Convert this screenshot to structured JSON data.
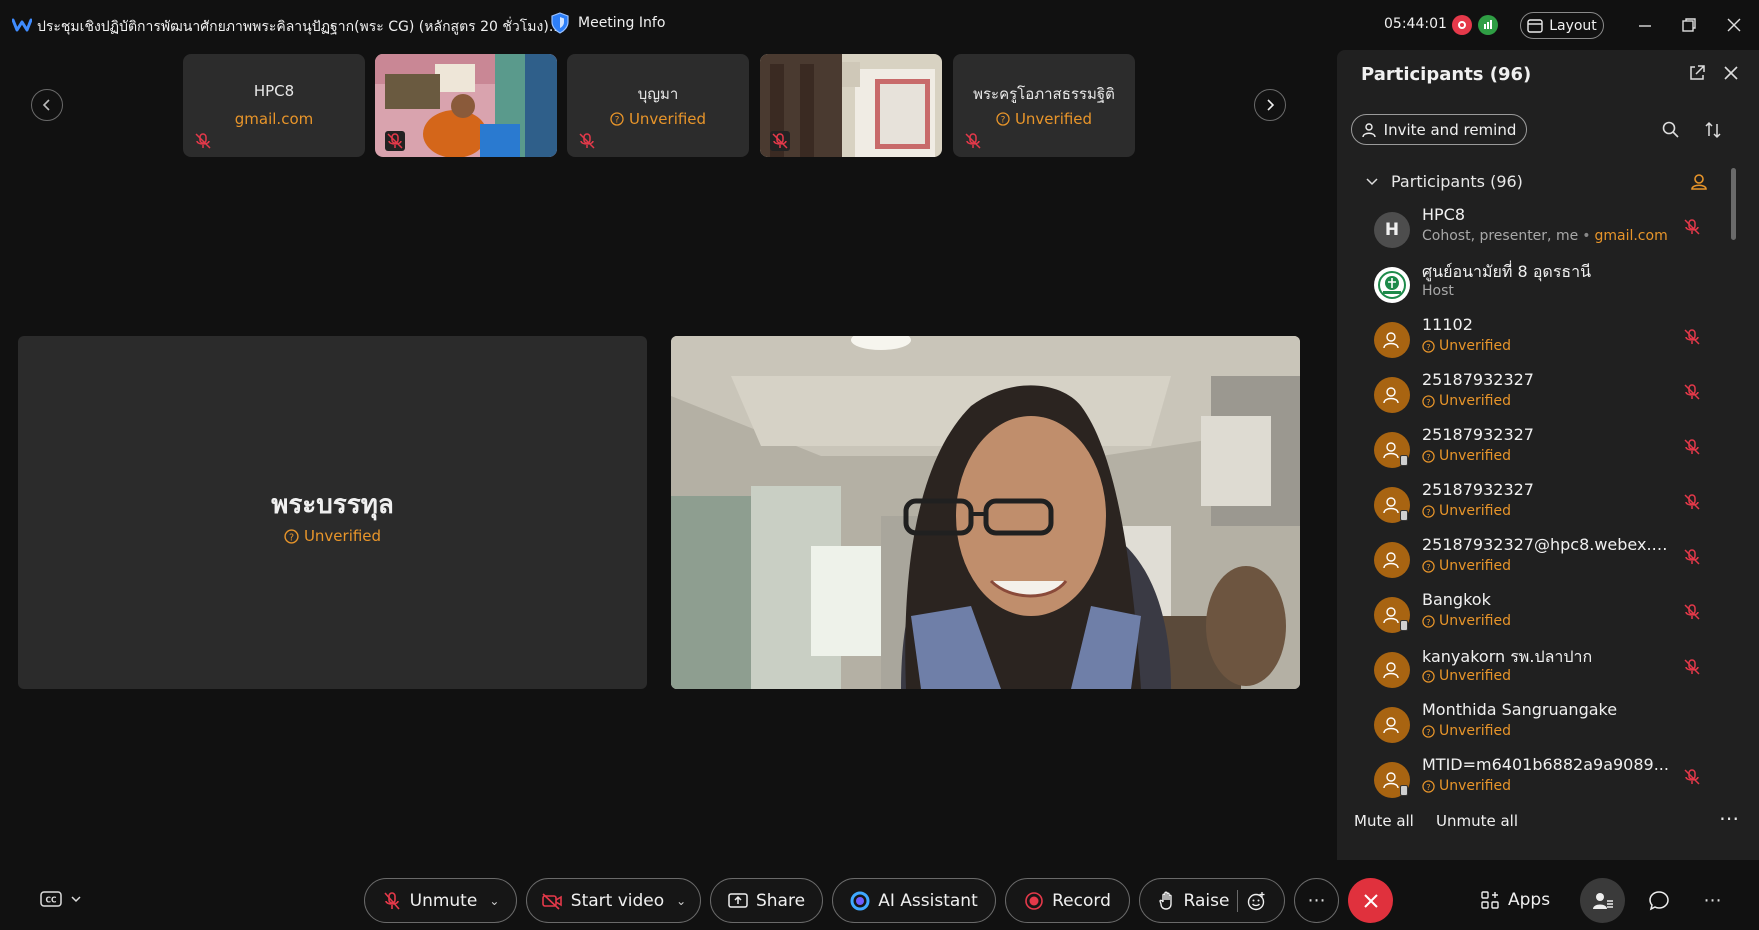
{
  "titlebar": {
    "meeting_title": "ประชุมเชิงปฏิบัติการพัฒนาศักยภาพพระคิลานุปัฏฐาก(พระ CG) (หลักสูตร 20 ชั่วโมง)...",
    "meeting_info": "Meeting Info",
    "clock": "05:44:01",
    "layout": "Layout"
  },
  "thumbnails": [
    {
      "name": "HPC8",
      "sub": "gmail.com",
      "kind": "text"
    },
    {
      "name": "",
      "sub": "",
      "kind": "video"
    },
    {
      "name": "บุญมา",
      "sub": "Unverified",
      "kind": "text"
    },
    {
      "name": "",
      "sub": "",
      "kind": "video"
    },
    {
      "name": "พระครูโอภาสธรรมฐิติ",
      "sub": "Unverified",
      "kind": "text"
    }
  ],
  "stage": {
    "left_name": "พระบรรทุล",
    "left_sub": "Unverified"
  },
  "panel": {
    "title": "Participants (96)",
    "invite": "Invite and remind",
    "section": "Participants (96)",
    "participants": [
      {
        "name": "HPC8",
        "role": "Cohost, presenter, me",
        "email": "gmail.com",
        "avatar": "letter",
        "initial": "H",
        "muted": true
      },
      {
        "name": "ศูนย์อนามัยที่ 8 อุดรธานี",
        "role": "Host",
        "avatar": "logo",
        "muted": false
      },
      {
        "name": "11102",
        "sub": "Unverified",
        "avatar": "guest",
        "phone": false,
        "muted": true
      },
      {
        "name": "25187932327",
        "sub": "Unverified",
        "avatar": "guest",
        "phone": false,
        "muted": true
      },
      {
        "name": "25187932327",
        "sub": "Unverified",
        "avatar": "guest",
        "phone": true,
        "muted": true
      },
      {
        "name": "25187932327",
        "sub": "Unverified",
        "avatar": "guest",
        "phone": true,
        "muted": true
      },
      {
        "name": "25187932327@hpc8.webex.c...",
        "sub": "Unverified",
        "avatar": "guest",
        "phone": false,
        "muted": true
      },
      {
        "name": "Bangkok",
        "sub": "Unverified",
        "avatar": "guest",
        "phone": true,
        "muted": true
      },
      {
        "name": "kanyakorn รพ.ปลาปาก",
        "sub": "Unverified",
        "avatar": "guest",
        "phone": false,
        "muted": true
      },
      {
        "name": "Monthida Sangruangake",
        "sub": "Unverified",
        "avatar": "guest",
        "phone": false,
        "muted": false
      },
      {
        "name": "MTID=m6401b6882a9a9089...",
        "sub": "Unverified",
        "avatar": "guest",
        "phone": true,
        "muted": true
      }
    ],
    "mute_all": "Mute all",
    "unmute_all": "Unmute all"
  },
  "toolbar": {
    "unmute": "Unmute",
    "start_video": "Start video",
    "share": "Share",
    "ai_assistant": "AI Assistant",
    "record": "Record",
    "raise": "Raise",
    "apps": "Apps"
  },
  "colors": {
    "accent_orange": "#e8952a",
    "mute_red": "#e5394a",
    "end_red": "#e0313d"
  }
}
